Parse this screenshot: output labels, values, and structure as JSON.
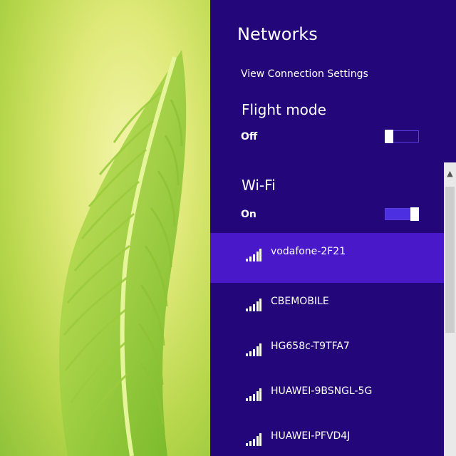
{
  "panel": {
    "title": "Networks",
    "connection_settings": "View Connection Settings",
    "accent_color": "#23077a",
    "selected_color": "#4919c9"
  },
  "flight_mode": {
    "label": "Flight mode",
    "state": "Off"
  },
  "wifi": {
    "label": "Wi-Fi",
    "state": "On",
    "networks": [
      {
        "name": "vodafone-2F21",
        "icon": "wifi-signal-icon",
        "selected": true
      },
      {
        "name": "CBEMOBILE",
        "icon": "wifi-signal-icon"
      },
      {
        "name": "HG658c-T9TFA7",
        "icon": "wifi-signal-icon"
      },
      {
        "name": "HUAWEI-9BSNGL-5G",
        "icon": "wifi-signal-icon"
      },
      {
        "name": "HUAWEI-PFVD4J",
        "icon": "wifi-signal-icon"
      }
    ]
  },
  "scrollbar": {
    "up_icon": "chevron-up-icon"
  }
}
